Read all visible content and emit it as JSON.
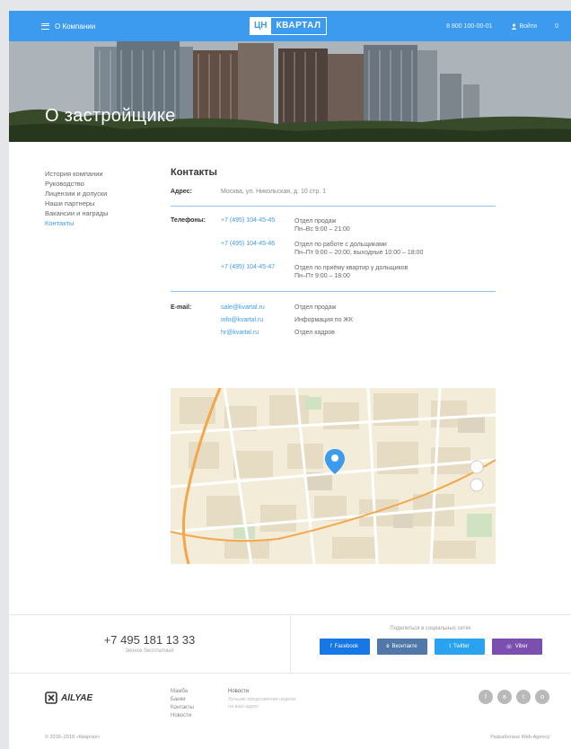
{
  "header": {
    "menu_label": "О Компании",
    "logo_left": "ЦН",
    "logo_right": "КВАРТАЛ",
    "phone": "8 800 100-00-01",
    "login": "Войти",
    "cart": "0"
  },
  "hero": {
    "title": "О застройщике"
  },
  "sidenav": {
    "items": [
      {
        "label": "История компании"
      },
      {
        "label": "Руководство"
      },
      {
        "label": "Лицензии и допуски"
      },
      {
        "label": "Наши партнеры"
      },
      {
        "label": "Вакансии и награды"
      },
      {
        "label": "Контакты"
      }
    ]
  },
  "contacts": {
    "title": "Контакты",
    "address_label": "Адрес:",
    "address": "Москва, ул. Никольская, д. 10 стр. 1",
    "phones_label": "Телефоны:",
    "phones": [
      {
        "number": "+7 (495) 104-45-45",
        "desc1": "Отдел продаж",
        "desc2": "Пн–Вс 9:00 – 21:00"
      },
      {
        "number": "+7 (495) 104-45-46",
        "desc1": "Отдел по работе с дольщиками",
        "desc2": "Пн–Пт 9:00 – 20:00, выходные 10:00 – 18:00"
      },
      {
        "number": "+7 (495) 104-45-47",
        "desc1": "Отдел по приёму квартир у дольщиков",
        "desc2": "Пн–Пт 9:00 – 18:00"
      }
    ],
    "email_label": "E-mail:",
    "emails": [
      {
        "email": "sale@kvartal.ru",
        "desc": "Отдел продаж"
      },
      {
        "email": "info@kvartal.ru",
        "desc": "Информация по ЖК"
      },
      {
        "email": "hr@kvartal.ru",
        "desc": "Отдел кадров"
      }
    ]
  },
  "footer": {
    "phone": "+7 495 181 13 33",
    "phone_sub": "Звонок бесплатный",
    "share_caption": "Поделиться в социальных сетях",
    "share_buttons": [
      {
        "label": "Facebook",
        "color": "#1877e6"
      },
      {
        "label": "Вконтакте",
        "color": "#5078a8"
      },
      {
        "label": "Twitter",
        "color": "#2aa3ef"
      },
      {
        "label": "Viber",
        "color": "#7b4fae"
      }
    ],
    "logo_text": "AlLYAE",
    "col1": [
      "Мамба",
      "Банки",
      "Контакты",
      "Новости"
    ],
    "col2_title": "Новости",
    "col2_sub": [
      "Лучшие предложения недели",
      "на ваш адрес"
    ],
    "social": [
      "f",
      "в",
      "t",
      "o"
    ],
    "copyright": "© 2016–2018 «Квартал»",
    "developer": "Разработано Web-Agency"
  },
  "colors": {
    "brand": "#3d9bef",
    "divider": "#8fc3f5"
  },
  "icons": {
    "menu": "hamburger-icon",
    "login": "user-icon",
    "map_marker": "map-pin-icon"
  }
}
